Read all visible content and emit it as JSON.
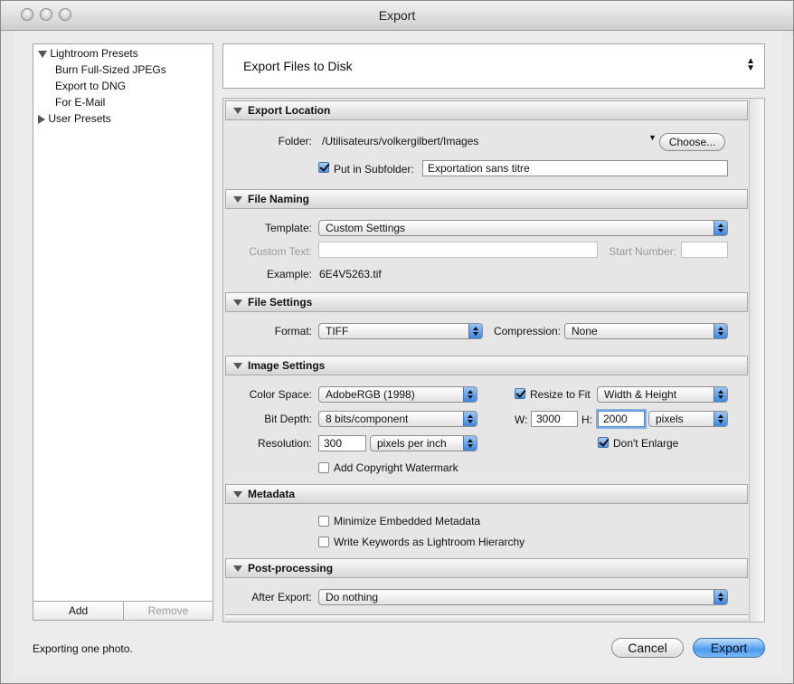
{
  "window": {
    "title": "Export"
  },
  "sidebar": {
    "groups": [
      {
        "label": "Lightroom Presets",
        "expanded": true,
        "items": [
          "Burn Full-Sized JPEGs",
          "Export to DNG",
          "For E-Mail"
        ]
      },
      {
        "label": "User Presets",
        "expanded": false,
        "items": []
      }
    ],
    "add_label": "Add",
    "remove_label": "Remove"
  },
  "export_to": {
    "value": "Export Files to Disk"
  },
  "sections": {
    "location": {
      "title": "Export Location",
      "folder_label": "Folder:",
      "folder_path": "/Utilisateurs/volkergilbert/Images",
      "choose_label": "Choose...",
      "subfolder_label": "Put in Subfolder:",
      "subfolder_checked": true,
      "subfolder_value": "Exportation sans titre"
    },
    "naming": {
      "title": "File Naming",
      "template_label": "Template:",
      "template_value": "Custom Settings",
      "custom_text_label": "Custom Text:",
      "custom_text_value": "",
      "start_number_label": "Start Number:",
      "start_number_value": "",
      "example_label": "Example:",
      "example_value": "6E4V5263.tif"
    },
    "file_settings": {
      "title": "File Settings",
      "format_label": "Format:",
      "format_value": "TIFF",
      "compression_label": "Compression:",
      "compression_value": "None"
    },
    "image": {
      "title": "Image Settings",
      "color_space_label": "Color Space:",
      "color_space_value": "AdobeRGB (1998)",
      "bit_depth_label": "Bit Depth:",
      "bit_depth_value": "8 bits/component",
      "resolution_label": "Resolution:",
      "resolution_value": "300",
      "resolution_unit": "pixels per inch",
      "watermark_label": "Add Copyright Watermark",
      "watermark_checked": false,
      "resize_label": "Resize to Fit",
      "resize_checked": true,
      "resize_mode": "Width & Height",
      "w_label": "W:",
      "w_value": "3000",
      "h_label": "H:",
      "h_value": "2000",
      "size_unit": "pixels",
      "dont_enlarge_label": "Don't Enlarge",
      "dont_enlarge_checked": true
    },
    "metadata": {
      "title": "Metadata",
      "minimize_label": "Minimize Embedded Metadata",
      "minimize_checked": false,
      "keywords_label": "Write Keywords as Lightroom Hierarchy",
      "keywords_checked": false
    },
    "post": {
      "title": "Post-processing",
      "after_export_label": "After Export:",
      "after_export_value": "Do nothing"
    }
  },
  "footer": {
    "status_text": "Exporting one photo.",
    "cancel_label": "Cancel",
    "export_label": "Export"
  },
  "colors": {
    "accent": "#4c9af0",
    "window_bg": "#ececec"
  }
}
